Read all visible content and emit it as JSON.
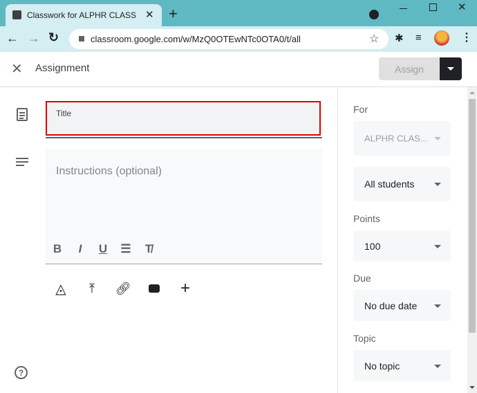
{
  "browser": {
    "tab_title": "Classwork for ALPHR CLASS SAM",
    "url": "classroom.google.com/w/MzQ0OTEwNTc0OTA0/t/all"
  },
  "header": {
    "title": "Assignment",
    "assign_label": "Assign"
  },
  "form": {
    "title_placeholder": "Title",
    "instructions_placeholder": "Instructions (optional)",
    "format_buttons": [
      "bold",
      "italic",
      "underline",
      "bulleted-list",
      "clear-formatting"
    ],
    "attach_buttons": [
      "google-drive",
      "upload",
      "link",
      "youtube",
      "create"
    ]
  },
  "sidebar": {
    "for_label": "For",
    "class_value": "ALPHR CLAS...",
    "students_value": "All students",
    "points_label": "Points",
    "points_value": "100",
    "due_label": "Due",
    "due_value": "No due date",
    "topic_label": "Topic",
    "topic_value": "No topic"
  },
  "colors": {
    "accent_teal": "#5fb9c3",
    "title_highlight": "#e00000"
  }
}
